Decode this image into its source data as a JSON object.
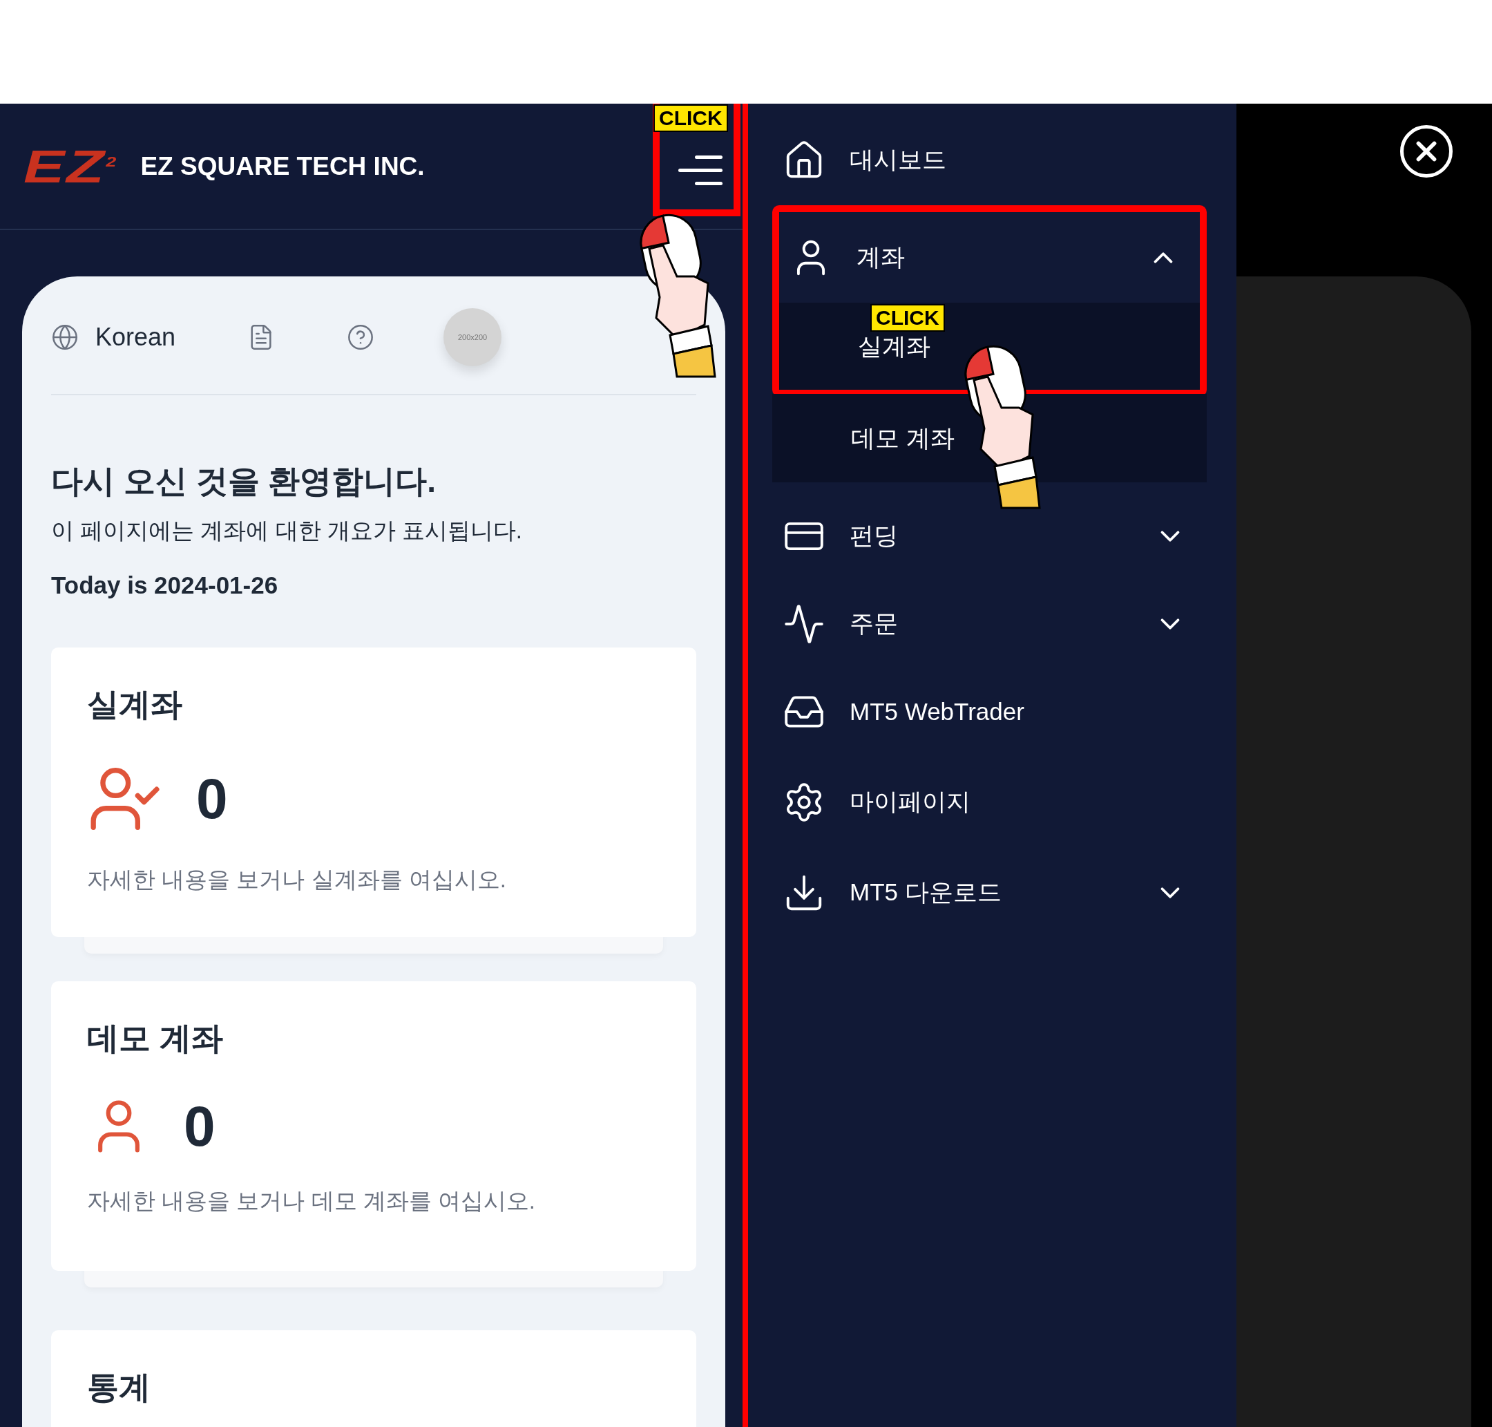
{
  "header": {
    "logo": "EZ",
    "logo_sup": "2",
    "company": "EZ SQUARE TECH INC.",
    "menu_button": {
      "highlighted": true,
      "callout": "CLICK"
    }
  },
  "toolbar": {
    "language": "Korean",
    "avatar": "200x200"
  },
  "welcome": {
    "title": "다시 오신 것을 환영합니다.",
    "subtitle": "이 페이지에는 계좌에 대한 개요가 표시됩니다.",
    "date": "Today is 2024-01-26"
  },
  "cards": [
    {
      "title": "실계좌",
      "count": "0",
      "description": "자세한 내용을 보거나 실계좌를 여십시오."
    },
    {
      "title": "데모 계좌",
      "count": "0",
      "description": "자세한 내용을 보거나 데모 계좌를 여십시오."
    },
    {
      "title": "통계"
    }
  ],
  "menu": [
    {
      "label": "대시보드",
      "kind": "link"
    },
    {
      "label": "계좌",
      "kind": "group",
      "expanded": true,
      "highlighted": true,
      "children": [
        {
          "label": "실계좌",
          "callout": "CLICK"
        },
        {
          "label": "데모 계좌"
        }
      ]
    },
    {
      "label": "펀딩",
      "kind": "group",
      "expanded": false
    },
    {
      "label": "주문",
      "kind": "group",
      "expanded": false
    },
    {
      "label": "MT5 WebTrader",
      "kind": "link"
    },
    {
      "label": "마이페이지",
      "kind": "link"
    },
    {
      "label": "MT5 다운로드",
      "kind": "group",
      "expanded": false
    }
  ]
}
